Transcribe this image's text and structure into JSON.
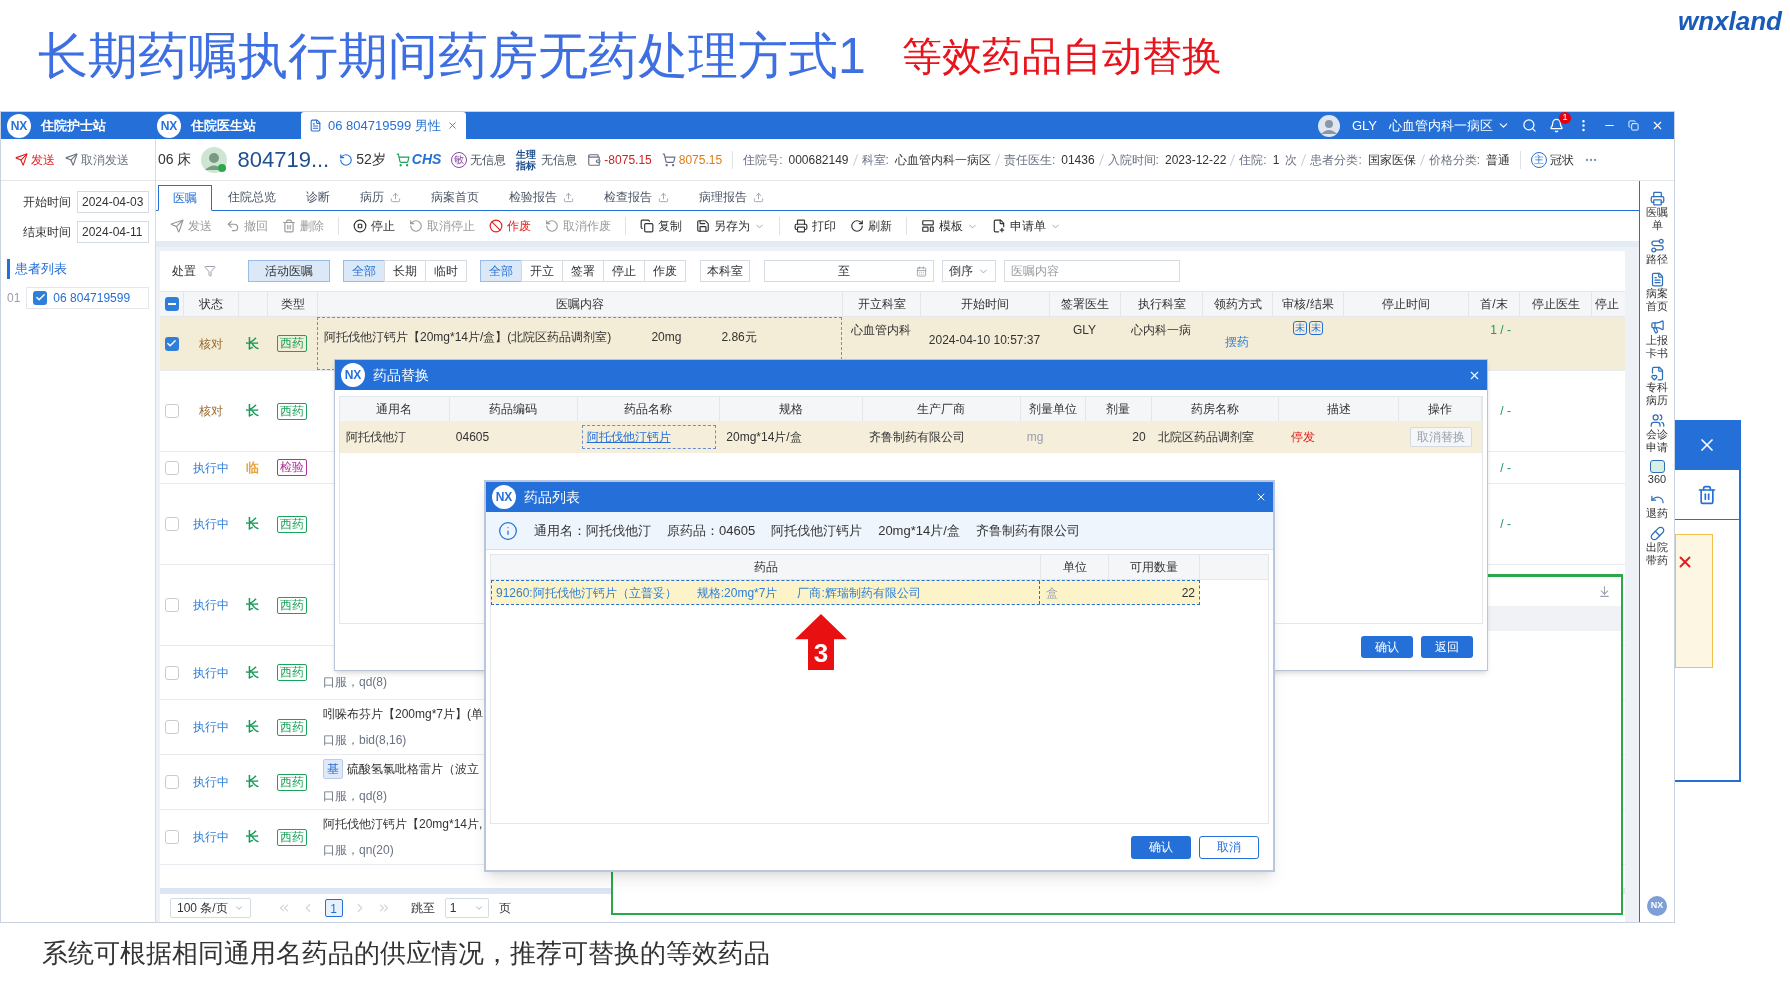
{
  "slide": {
    "title": "长期药嘱执行期间药房无药处理方式1",
    "subtitle": "等效药品自动替换",
    "logo": "wnxland",
    "caption": "系统可根据相同通用名药品的供应情况，推荐可替换的等效药品"
  },
  "window": {
    "apps": [
      {
        "logo": "NX",
        "name": "住院护士站"
      },
      {
        "logo": "NX",
        "name": "住院医生站"
      }
    ],
    "patient_tab": {
      "label": "06 804719599 男性",
      "selected": true
    },
    "user": "GLY",
    "department": "心血管内科一病区",
    "notifications": "1"
  },
  "send_bar": [
    {
      "label": "发送",
      "kind": "primary"
    },
    {
      "label": "取消发送",
      "kind": "plain"
    }
  ],
  "patient": {
    "bed": "06 床",
    "id": "804719...",
    "age": "52岁",
    "insurance_logo": "CHS",
    "allergy_badge": "敏",
    "allergy": "无信息",
    "vitals_badge": "生理指标",
    "vitals": "无信息",
    "balance": "-8075.15",
    "cost": "8075.15",
    "details": [
      {
        "label": "住院号:",
        "value": "000682149"
      },
      {
        "label": "科室:",
        "value": "心血管内科一病区"
      },
      {
        "label": "责任医生:",
        "value": "01436"
      },
      {
        "label": "入院时间:",
        "value": "2023-12-22"
      },
      {
        "label": "住院:",
        "value": "1",
        "suffix": "次"
      },
      {
        "label": "患者分类:",
        "value": "国家医保"
      },
      {
        "label": "价格分类:",
        "value": "普通"
      }
    ],
    "diagnosis_badge": "主",
    "diagnosis": "冠状"
  },
  "date_filter": {
    "start_label": "开始时间",
    "start": "2024-04-03",
    "end_label": "结束时间",
    "end": "2024-04-11"
  },
  "patient_list": {
    "title": "患者列表",
    "items": [
      {
        "index": "01",
        "label": "06 804719599",
        "checked": true
      }
    ]
  },
  "tabs": [
    {
      "label": "医嘱",
      "selected": true,
      "export": false
    },
    {
      "label": "住院总览",
      "selected": false,
      "export": false
    },
    {
      "label": "诊断",
      "selected": false,
      "export": false
    },
    {
      "label": "病历",
      "selected": false,
      "export": true
    },
    {
      "label": "病案首页",
      "selected": false,
      "export": false
    },
    {
      "label": "检验报告",
      "selected": false,
      "export": true
    },
    {
      "label": "检查报告",
      "selected": false,
      "export": true
    },
    {
      "label": "病理报告",
      "selected": false,
      "export": true
    }
  ],
  "toolbar": [
    {
      "label": "发送",
      "disabled": true,
      "danger": false,
      "dropdown": false
    },
    {
      "label": "撤回",
      "disabled": true,
      "danger": false,
      "dropdown": false
    },
    {
      "label": "删除",
      "disabled": true,
      "danger": false,
      "dropdown": false
    },
    {
      "label": "停止",
      "disabled": false,
      "danger": false,
      "dropdown": false
    },
    {
      "label": "取消停止",
      "disabled": true,
      "danger": false,
      "dropdown": false
    },
    {
      "label": "作废",
      "disabled": false,
      "danger": true,
      "dropdown": false
    },
    {
      "label": "取消作废",
      "disabled": true,
      "danger": false,
      "dropdown": false
    },
    {
      "label": "复制",
      "disabled": false,
      "danger": false,
      "dropdown": false
    },
    {
      "label": "另存为",
      "disabled": false,
      "danger": false,
      "dropdown": true
    },
    {
      "label": "打印",
      "disabled": false,
      "danger": false,
      "dropdown": false
    },
    {
      "label": "刷新",
      "disabled": false,
      "danger": false,
      "dropdown": false
    },
    {
      "label": "模板",
      "disabled": false,
      "danger": false,
      "dropdown": true
    },
    {
      "label": "申请单",
      "disabled": false,
      "danger": false,
      "dropdown": true
    }
  ],
  "order_filter": {
    "label": "处置",
    "active_button": {
      "label": "活动医嘱",
      "selected": true
    },
    "term_options": [
      {
        "label": "全部",
        "selected": true
      },
      {
        "label": "长期",
        "selected": false
      },
      {
        "label": "临时",
        "selected": false
      }
    ],
    "status_options": [
      {
        "label": "全部",
        "selected": true
      },
      {
        "label": "开立",
        "selected": false
      },
      {
        "label": "签署",
        "selected": false
      },
      {
        "label": "停止",
        "selected": false
      },
      {
        "label": "作废",
        "selected": false
      }
    ],
    "dept_button": "本科室",
    "range_separator": "至",
    "sort": "倒序",
    "search_placeholder": "医嘱内容"
  },
  "table": {
    "header_indeterminate": true,
    "columns": [
      "状态",
      "类型",
      "医嘱内容",
      "开立科室",
      "开始时间",
      "签署医生",
      "执行科室",
      "领药方式",
      "审核/结果",
      "停止时间",
      "首/末",
      "停止医生",
      "停止"
    ],
    "rows": [
      {
        "checked": true,
        "selected": true,
        "status": {
          "text": "核对",
          "color": "#9b6b2f"
        },
        "term": {
          "text": "长",
          "color": "#1a9a5a"
        },
        "type": {
          "text": "西药",
          "color": "#1aa35a"
        },
        "lines": [
          {
            "kind": "name",
            "text": "阿托伐他汀钙片【20mg*14片/盒】(北院区药品调剂室)"
          }
        ],
        "dose": "20mg",
        "price": "2.86元",
        "dept": "心血管内科",
        "start": "2024-04-10 10:57:37",
        "doctor": "GLY",
        "exec_dept": "心内科一病",
        "method": "摆药",
        "review": [
          "未",
          "未"
        ],
        "first_last": "1 / -"
      },
      {
        "checked": false,
        "selected": false,
        "status": {
          "text": "核对",
          "color": "#9b6b2f"
        },
        "term": {
          "text": "长",
          "color": "#1a9a5a"
        },
        "type": {
          "text": "西药",
          "color": "#1aa35a"
        },
        "first_last": "/ -"
      },
      {
        "checked": false,
        "selected": false,
        "status": {
          "text": "执行中",
          "color": "#2f7fd8"
        },
        "term": {
          "text": "临",
          "color": "#e8a33a"
        },
        "type": {
          "text": "检验",
          "color": "#b0329a"
        },
        "first_last": "/ -"
      },
      {
        "checked": false,
        "selected": false,
        "status": {
          "text": "执行中",
          "color": "#2f7fd8"
        },
        "term": {
          "text": "长",
          "color": "#1a9a5a"
        },
        "type": {
          "text": "西药",
          "color": "#1aa35a"
        },
        "first_last": "/ -"
      },
      {
        "checked": false,
        "selected": false,
        "status": {
          "text": "执行中",
          "color": "#2f7fd8"
        },
        "term": {
          "text": "长",
          "color": "#1a9a5a"
        },
        "type": {
          "text": "西药",
          "color": "#1aa35a"
        }
      },
      {
        "checked": false,
        "selected": false,
        "status": {
          "text": "执行中",
          "color": "#2f7fd8"
        },
        "term": {
          "text": "长",
          "color": "#1a9a5a"
        },
        "type": {
          "text": "西药",
          "color": "#1aa35a"
        },
        "lines": [
          {
            "kind": "usage",
            "text": "口服，qd(8)"
          }
        ]
      },
      {
        "checked": false,
        "selected": false,
        "status": {
          "text": "执行中",
          "color": "#2f7fd8"
        },
        "term": {
          "text": "长",
          "color": "#1a9a5a"
        },
        "type": {
          "text": "西药",
          "color": "#1aa35a"
        },
        "lines": [
          {
            "kind": "name",
            "text": "吲哚布芬片【200mg*7片】(单"
          },
          {
            "kind": "usage",
            "text": "口服，bid(8,16)"
          }
        ]
      },
      {
        "checked": false,
        "selected": false,
        "status": {
          "text": "执行中",
          "color": "#2f7fd8"
        },
        "term": {
          "text": "长",
          "color": "#1a9a5a"
        },
        "type": {
          "text": "西药",
          "color": "#1aa35a"
        },
        "badge": "基",
        "lines": [
          {
            "kind": "name",
            "text": "硫酸氢氯吡格雷片（波立"
          },
          {
            "kind": "usage",
            "text": "口服，qd(8)"
          }
        ]
      },
      {
        "checked": false,
        "selected": false,
        "status": {
          "text": "执行中",
          "color": "#2f7fd8"
        },
        "term": {
          "text": "长",
          "color": "#1a9a5a"
        },
        "type": {
          "text": "西药",
          "color": "#1aa35a"
        },
        "lines": [
          {
            "kind": "name",
            "text": "阿托伐他汀钙片【20mg*14片,"
          },
          {
            "kind": "usage",
            "text": "口服，qn(20)"
          }
        ]
      }
    ]
  },
  "pagination": {
    "page_size": "100 条/页",
    "pages": [
      {
        "label": "1",
        "selected": true
      }
    ],
    "jump_label": "跳至",
    "jump_value": "1",
    "page_suffix": "页"
  },
  "sidebar": {
    "items": [
      "医嘱单",
      "路径",
      "病案首页",
      "上报卡书",
      "专科病历",
      "会诊申请",
      "360",
      "退药",
      "出院带药"
    ],
    "logo": "NX"
  },
  "replace_dialog": {
    "logo": "NX",
    "title": "药品替换",
    "columns": [
      "通用名",
      "药品编码",
      "药品名称",
      "规格",
      "生产厂商",
      "剂量单位",
      "剂量",
      "药房名称",
      "描述",
      "操作"
    ],
    "rows": [
      {
        "selected": true,
        "cells": [
          {
            "kind": "text",
            "text": "阿托伐他汀"
          },
          {
            "kind": "text",
            "text": "04605"
          },
          {
            "kind": "link",
            "text": "阿托伐他汀钙片"
          },
          {
            "kind": "text",
            "text": "20mg*14片/盒"
          },
          {
            "kind": "text",
            "text": "齐鲁制药有限公司"
          },
          {
            "kind": "muted",
            "text": "mg"
          },
          {
            "kind": "number",
            "text": "20"
          },
          {
            "kind": "text",
            "text": "北院区药品调剂室"
          },
          {
            "kind": "alert",
            "text": "停发"
          },
          {
            "kind": "button",
            "text": "取消替换"
          }
        ]
      }
    ],
    "buttons": [
      {
        "label": "确认",
        "kind": "primary"
      },
      {
        "label": "返回",
        "kind": "primary"
      }
    ]
  },
  "drug_list_dialog": {
    "logo": "NX",
    "title": "药品列表",
    "info": [
      "通用名：阿托伐他汀",
      "原药品：04605",
      "阿托伐他汀钙片",
      "20mg*14片/盒",
      "齐鲁制药有限公司"
    ],
    "columns": [
      "药品",
      "单位",
      "可用数量"
    ],
    "rows": [
      {
        "selected": true,
        "parts": [
          "91260:阿托伐他汀钙片（立普妥）",
          "规格:20mg*7片",
          "厂商:辉瑞制药有限公司"
        ],
        "unit": "盒",
        "quantity": "22"
      }
    ],
    "buttons": [
      {
        "label": "确认",
        "kind": "primary"
      },
      {
        "label": "取消",
        "kind": "secondary"
      }
    ]
  },
  "callout": {
    "number": "3"
  }
}
